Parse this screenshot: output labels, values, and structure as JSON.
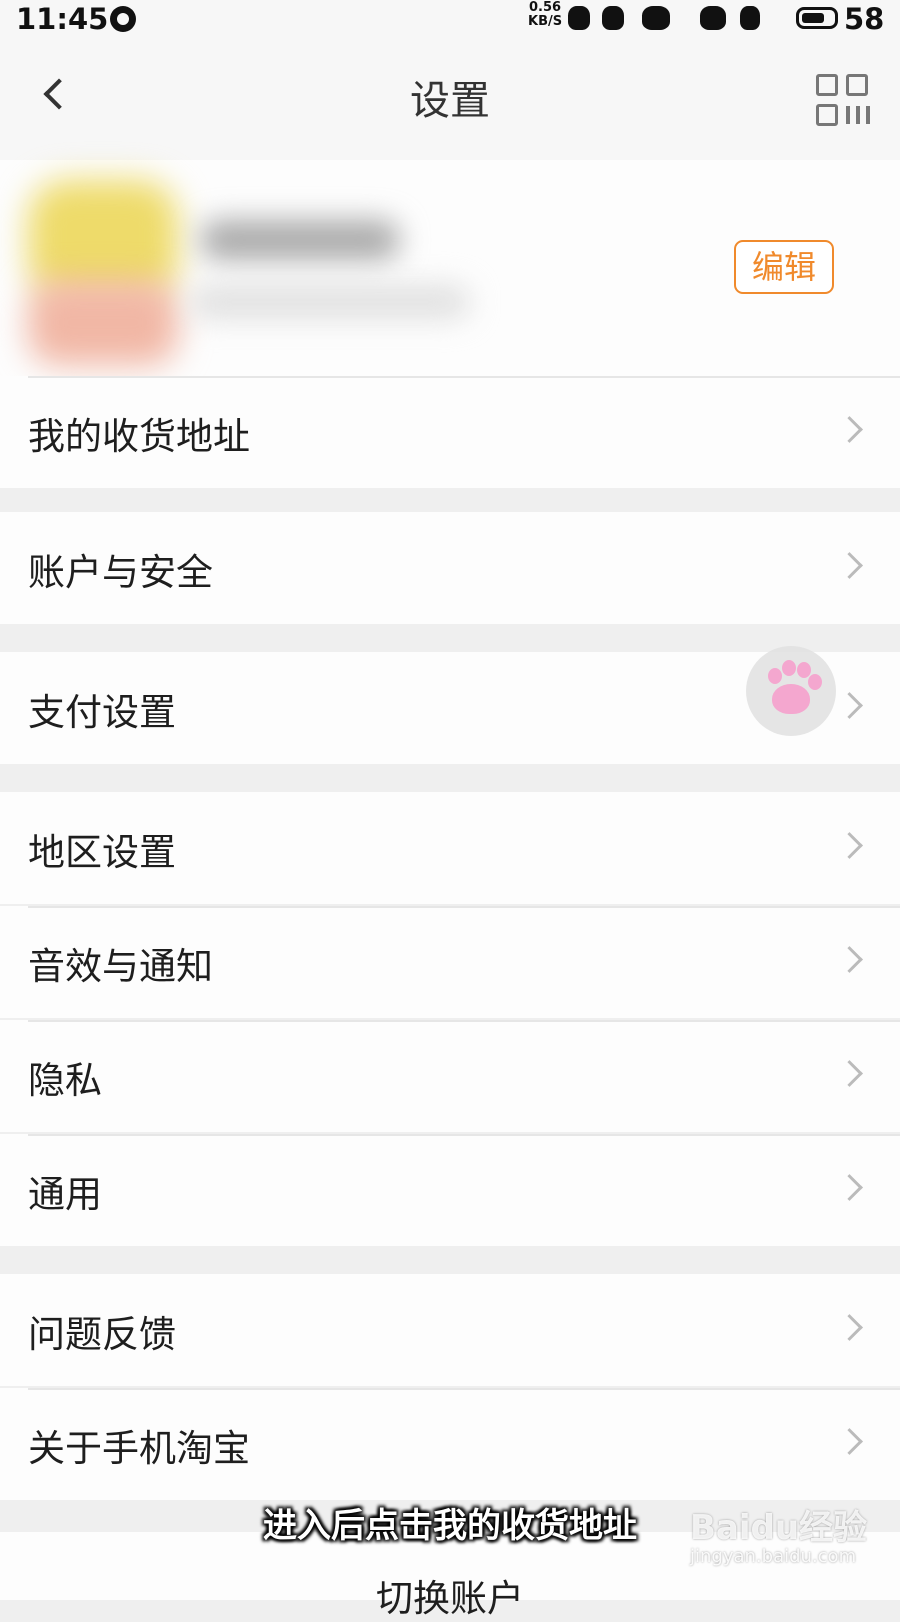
{
  "status_bar": {
    "time": "11:45",
    "net_speed_value": "0.56",
    "net_speed_unit": "KB/S",
    "battery": "58"
  },
  "header": {
    "title": "设置",
    "back_icon": "chevron-left-icon",
    "qr_icon": "qr-code-icon"
  },
  "profile": {
    "edit_label": "编辑",
    "accent_color": "#f08a2c"
  },
  "menu": {
    "address": "我的收货地址",
    "account_security": "账户与安全",
    "payment": "支付设置",
    "region": "地区设置",
    "sound_notify": "音效与通知",
    "privacy": "隐私",
    "general": "通用",
    "feedback": "问题反馈",
    "about": "关于手机淘宝"
  },
  "bottom": {
    "switch_account": "切换账户"
  },
  "overlay": {
    "subtitle": "进入后点击我的收货地址",
    "watermark_logo": "Baidu经验",
    "watermark_url": "jingyan.baidu.com"
  }
}
